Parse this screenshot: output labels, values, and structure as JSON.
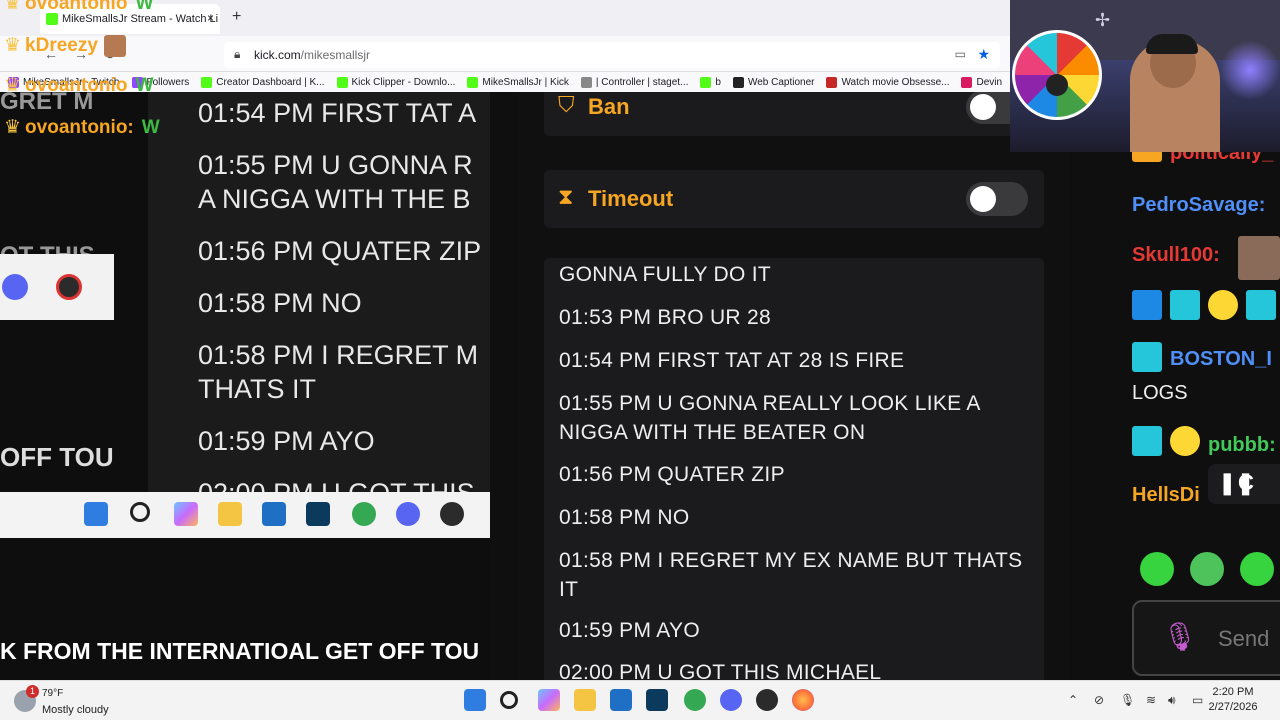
{
  "browser": {
    "tab_title": "MikeSmallsJr Stream - Watch Li",
    "tab_close": "×",
    "new_tab": "+",
    "url_host": "kick.com",
    "url_path": "/mikesmallsjr",
    "bookmarks": [
      {
        "label": "MikeSmallsJr - Twitch",
        "color": "#9146ff"
      },
      {
        "label": "Followers",
        "color": "#9146ff"
      },
      {
        "label": "Creator Dashboard | K...",
        "color": "#53fc18"
      },
      {
        "label": "Kick Clipper - Downlo...",
        "color": "#53fc18"
      },
      {
        "label": "MikeSmallsJr | Kick",
        "color": "#53fc18"
      },
      {
        "label": "| Controller | staget...",
        "color": "#888888"
      },
      {
        "label": "b",
        "color": "#53fc18"
      },
      {
        "label": "Web Captioner",
        "color": "#222222"
      },
      {
        "label": "Watch movie Obsesse...",
        "color": "#c62828"
      },
      {
        "label": "Devin",
        "color": "#d81b60"
      }
    ]
  },
  "overlay_chat": {
    "names": [
      "ovoantonio",
      "kDreezy",
      "ovoantonio",
      "ovoantonio:"
    ],
    "w_emote": "W"
  },
  "left_panel": {
    "mirror_lines": [
      "01:54 PM FIRST TAT A",
      "01:55 PM U GONNA R\nA NIGGA WITH THE B",
      "01:56 PM QUATER ZIP",
      "01:58 PM NO",
      "01:58 PM I REGRET M\nTHATS IT",
      "01:59 PM AYO",
      "02:00 PM U GOT THIS"
    ],
    "side_top": "GRET M",
    "side_mid": "OT THIS",
    "side_bottom": "OFF TOU",
    "ticker": "K FROM THE INTERNATIOAL GET OFF TOU"
  },
  "mod_panel": {
    "ban_label": "Ban",
    "timeout_label": "Timeout",
    "log": [
      "GONNA FULLY DO IT",
      "01:53 PM BRO UR 28",
      "01:54 PM FIRST TAT AT 28 IS FIRE",
      "01:55 PM U GONNA REALLY LOOK LIKE A NIGGA WITH THE BEATER ON",
      "01:56 PM QUATER ZIP",
      "01:58 PM NO",
      "01:58 PM I REGRET MY EX NAME BUT THATS IT",
      "01:59 PM AYO",
      "02:00 PM U GOT THIS MICHAEL"
    ]
  },
  "right_chat": {
    "users": [
      {
        "name": "politically_",
        "color": "#e53935"
      },
      {
        "name": "PedroSavage:",
        "color": "#4f8ff7"
      },
      {
        "name": "Skull100:",
        "color": "#e53935"
      },
      {
        "name": "BOSTON_I",
        "color": "#4f8ff7"
      },
      {
        "name": "pubbb:",
        "color": "#43c85a"
      },
      {
        "name": "HellsDi",
        "color": "#f6a623"
      }
    ],
    "logs_text": "LOGS",
    "pause_label": "C",
    "send_label": "Send"
  },
  "taskbar": {
    "weather_badge": "1",
    "temp": "79°F",
    "condition": "Mostly cloudy",
    "time": "2:20 PM",
    "date": "2/27/2026"
  }
}
